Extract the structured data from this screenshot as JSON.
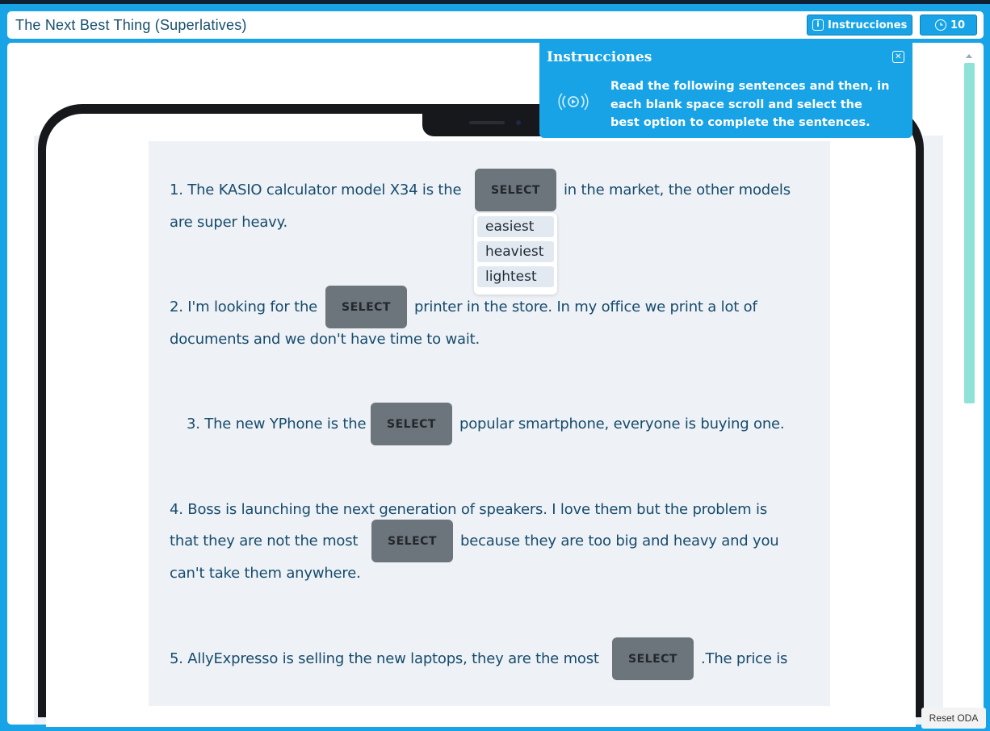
{
  "header": {
    "title": "The Next Best Thing (Superlatives)",
    "instructions_label": "Instrucciones",
    "timer_value": "10"
  },
  "popup": {
    "title": "Instrucciones",
    "text": "Read the following sentences and then, in each blank space scroll and select the best option to complete the sentences."
  },
  "select_label": "SELECT",
  "questions": {
    "q1": {
      "a": "1. The KASIO calculator model X34 is the",
      "b": "in the market, the other models",
      "c": "are super heavy."
    },
    "q2": {
      "a": "2. I'm looking for the",
      "b": "printer in the store. In my office we print a lot of",
      "c": "documents and we don't have time to wait."
    },
    "q3": {
      "a": "3. The new YPhone is the",
      "b": "popular smartphone, everyone is buying one."
    },
    "q4": {
      "a": "4. Boss is launching the next generation of speakers. I love them but the problem is",
      "b": "that they are not the most",
      "c": "because they are too big and heavy and you",
      "d": "can't take them anywhere."
    },
    "q5": {
      "a": "5. AllyExpresso is selling the new laptops, they are the most",
      "b": ".The price is"
    }
  },
  "dropdown": {
    "options": [
      "easiest",
      "heaviest",
      "lightest"
    ]
  },
  "reset_label": "Reset ODA",
  "colors": {
    "brand": "#17a3e6",
    "text": "#174b6b",
    "select_bg": "#6c757c",
    "scroll_thumb": "#8fe3d6"
  },
  "icons": {
    "info": "info-icon",
    "clock": "clock-icon",
    "close": "close-icon",
    "audio": "audio-icon"
  }
}
